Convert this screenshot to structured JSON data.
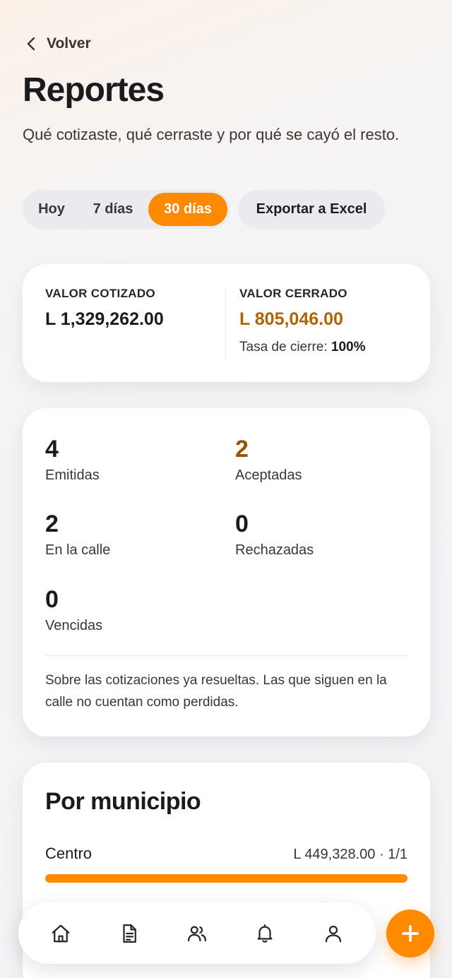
{
  "header": {
    "back_label": "Volver",
    "title": "Reportes",
    "subtitle": "Qué cotizaste, qué cerraste y por qué se cayó el resto."
  },
  "period_filter": {
    "options": [
      "Hoy",
      "7 días",
      "30 días"
    ],
    "selected": "30 días"
  },
  "export_label": "Exportar a Excel",
  "values": {
    "quoted_label": "VALOR COTIZADO",
    "quoted_amount": "L 1,329,262.00",
    "closed_label": "VALOR CERRADO",
    "closed_amount": "L 805,046.00",
    "close_rate_label": "Tasa de cierre:",
    "close_rate_value": "100%"
  },
  "counts": {
    "issued": {
      "value": "4",
      "label": "Emitidas"
    },
    "accepted": {
      "value": "2",
      "label": "Aceptadas"
    },
    "pending": {
      "value": "2",
      "label": "En la calle"
    },
    "rejected": {
      "value": "0",
      "label": "Rechazadas"
    },
    "expired": {
      "value": "0",
      "label": "Vencidas"
    },
    "note": "Sobre las cotizaciones ya resueltas. Las que siguen en la calle no cuentan como perdidas."
  },
  "municipalities": {
    "title": "Por municipio",
    "rows": [
      {
        "name": "Centro",
        "amount": "L 449,328.00 · 1/1",
        "fill": 1.0
      }
    ]
  },
  "nav": {
    "items": [
      "home-icon",
      "document-icon",
      "users-icon",
      "bell-icon",
      "user-icon"
    ]
  },
  "colors": {
    "accent": "#ff8a00",
    "closed_amount": "#b06400",
    "accepted_count": "#9a5300"
  }
}
